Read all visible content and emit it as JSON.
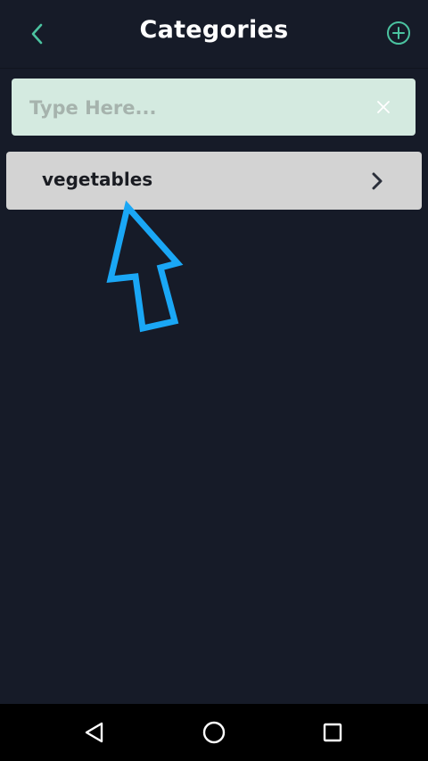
{
  "app_bar": {
    "title": "Categories",
    "back_icon": "chevron-left-icon",
    "add_icon": "plus-circle-icon"
  },
  "search": {
    "placeholder": "Type Here...",
    "value": "",
    "clear_icon": "close-icon"
  },
  "categories": [
    {
      "label": "vegetables",
      "icon": "chevron-right-icon"
    }
  ],
  "annotation": {
    "icon": "arrow-up-icon",
    "color": "#1aa7f5"
  },
  "system_nav": {
    "back_icon": "triangle-back-icon",
    "home_icon": "circle-home-icon",
    "recents_icon": "square-recents-icon"
  },
  "colors": {
    "background": "#161b28",
    "accent": "#4bc3a0",
    "search_bg": "#d4eae0",
    "item_bg": "#d3d3d3"
  }
}
